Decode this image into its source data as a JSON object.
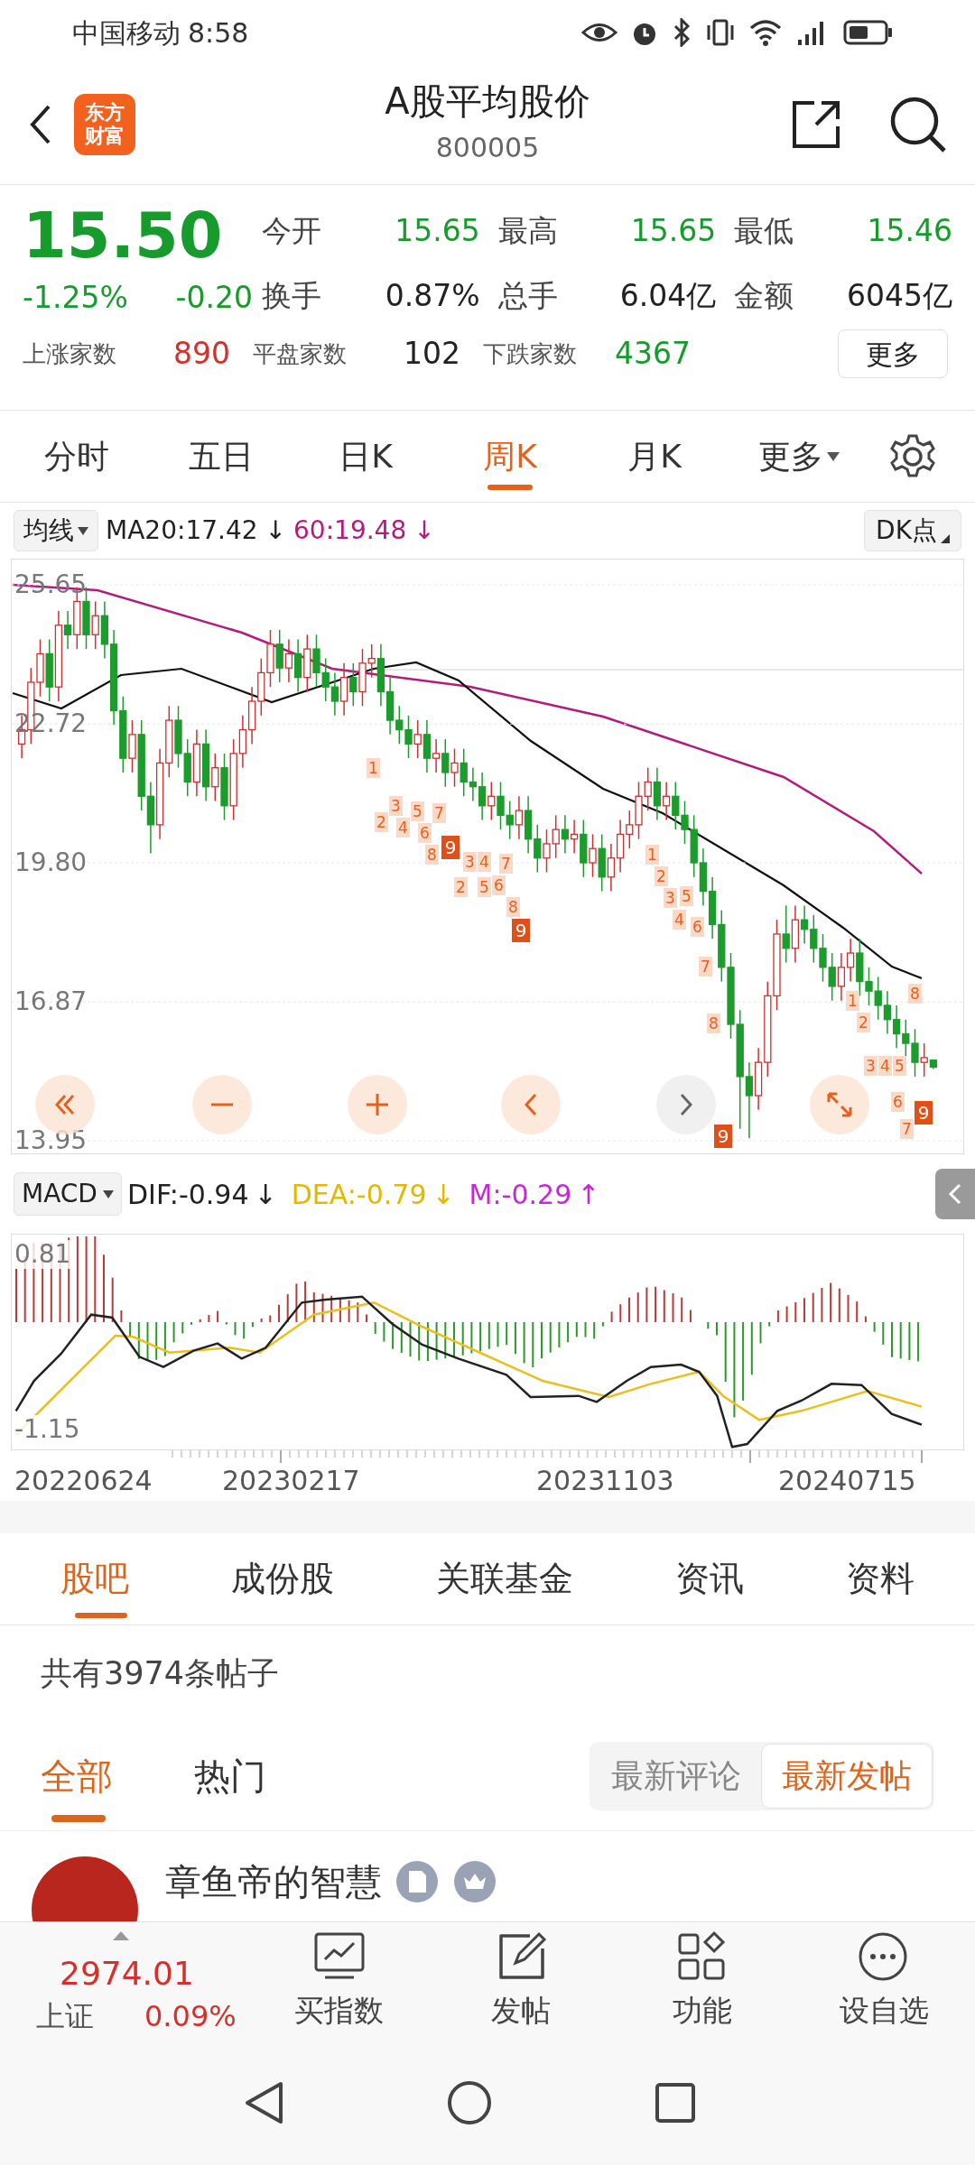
{
  "status_bar": {
    "carrier": "中国移动",
    "time": "8:58"
  },
  "header": {
    "logo_text": [
      "东方",
      "财富"
    ],
    "title": "A股平均股价",
    "code": "800005"
  },
  "quote": {
    "price": "15.50",
    "change_pct": "-1.25%",
    "change": "-0.20",
    "color": "#179b2c",
    "stats": [
      {
        "label": "今开",
        "value": "15.65",
        "color": "#179b2c"
      },
      {
        "label": "最高",
        "value": "15.65",
        "color": "#179b2c"
      },
      {
        "label": "最低",
        "value": "15.46",
        "color": "#179b2c"
      },
      {
        "label": "换手",
        "value": "0.87%",
        "color": "#222222"
      },
      {
        "label": "总手",
        "value": "6.04亿",
        "color": "#222222"
      },
      {
        "label": "金额",
        "value": "6045亿",
        "color": "#222222"
      }
    ],
    "breadth": [
      {
        "label": "上涨家数",
        "value": "890",
        "color": "#d6302a"
      },
      {
        "label": "平盘家数",
        "value": "102",
        "color": "#222222"
      },
      {
        "label": "下跌家数",
        "value": "4367",
        "color": "#179b2c"
      }
    ],
    "more_button": "更多"
  },
  "period_tabs": [
    {
      "label": "分时",
      "selected": false,
      "dropdown": false
    },
    {
      "label": "五日",
      "selected": false,
      "dropdown": false
    },
    {
      "label": "日K",
      "selected": false,
      "dropdown": false
    },
    {
      "label": "周K",
      "selected": true,
      "dropdown": false
    },
    {
      "label": "月K",
      "selected": false,
      "dropdown": false
    },
    {
      "label": "更多",
      "selected": false,
      "dropdown": true
    }
  ],
  "ma_bar": {
    "selector": "均线",
    "ma20": "MA20:17.42",
    "ma20_arrow": "↓",
    "ma60": "60:19.48",
    "ma60_arrow": "↓",
    "signal_button": "DK点"
  },
  "kline": {
    "chart_data": {
      "type": "candlestick",
      "ylim": [
        13.95,
        25.65
      ],
      "grid": true,
      "yticks": [
        {
          "value": 25.65,
          "label": "25.65"
        },
        {
          "value": 22.72,
          "label": "22.72"
        },
        {
          "value": 19.8,
          "label": "19.80"
        },
        {
          "value": 16.87,
          "label": "16.87"
        },
        {
          "value": 13.95,
          "label": "13.95"
        }
      ],
      "ohlc": [
        [
          22.3,
          22.9,
          22.0,
          22.6
        ],
        [
          22.6,
          23.9,
          22.3,
          23.6
        ],
        [
          23.6,
          24.5,
          23.3,
          24.2
        ],
        [
          24.2,
          24.5,
          23.2,
          23.5
        ],
        [
          23.5,
          25.1,
          23.2,
          24.8
        ],
        [
          24.8,
          25.1,
          24.3,
          24.6
        ],
        [
          24.6,
          25.6,
          24.3,
          25.3
        ],
        [
          25.3,
          25.6,
          24.3,
          24.6
        ],
        [
          24.6,
          25.3,
          24.3,
          25.0
        ],
        [
          25.0,
          25.3,
          24.1,
          24.4
        ],
        [
          24.4,
          24.7,
          22.7,
          23.0
        ],
        [
          23.0,
          23.3,
          21.7,
          22.0
        ],
        [
          22.0,
          22.8,
          21.7,
          22.5
        ],
        [
          22.5,
          22.8,
          20.9,
          21.2
        ],
        [
          21.2,
          21.5,
          20.0,
          20.6
        ],
        [
          20.6,
          22.2,
          20.3,
          21.9
        ],
        [
          21.9,
          23.1,
          21.6,
          22.8
        ],
        [
          22.8,
          23.1,
          21.8,
          22.1
        ],
        [
          22.1,
          22.4,
          21.2,
          21.5
        ],
        [
          21.5,
          22.6,
          21.2,
          22.3
        ],
        [
          22.3,
          22.6,
          21.1,
          21.4
        ],
        [
          21.4,
          22.1,
          21.1,
          21.8
        ],
        [
          21.8,
          22.1,
          20.7,
          21.0
        ],
        [
          21.0,
          22.4,
          20.7,
          22.1
        ],
        [
          22.1,
          22.9,
          21.8,
          22.6
        ],
        [
          22.6,
          23.5,
          22.3,
          23.2
        ],
        [
          23.2,
          24.1,
          22.9,
          23.8
        ],
        [
          23.8,
          24.7,
          23.5,
          24.4
        ],
        [
          24.4,
          24.7,
          23.6,
          23.9
        ],
        [
          23.9,
          24.5,
          23.6,
          24.2
        ],
        [
          24.2,
          24.5,
          23.4,
          23.7
        ],
        [
          23.7,
          24.6,
          23.4,
          24.3
        ],
        [
          24.3,
          24.6,
          23.5,
          23.8
        ],
        [
          23.8,
          24.1,
          23.2,
          23.5
        ],
        [
          23.5,
          23.8,
          22.9,
          23.2
        ],
        [
          23.2,
          24.0,
          22.9,
          23.7
        ],
        [
          23.7,
          24.0,
          23.1,
          23.4
        ],
        [
          23.4,
          24.3,
          23.1,
          24.0
        ],
        [
          24.0,
          24.4,
          23.7,
          24.1
        ],
        [
          24.1,
          24.4,
          23.1,
          23.4
        ],
        [
          23.4,
          23.7,
          22.5,
          22.8
        ],
        [
          22.8,
          23.1,
          22.3,
          22.6
        ],
        [
          22.6,
          22.9,
          22.0,
          22.3
        ],
        [
          22.3,
          22.8,
          22.0,
          22.5
        ],
        [
          22.5,
          22.8,
          21.7,
          22.0
        ],
        [
          22.0,
          22.4,
          21.7,
          22.1
        ],
        [
          22.1,
          22.4,
          21.4,
          21.7
        ],
        [
          21.7,
          22.2,
          21.4,
          21.9
        ],
        [
          21.9,
          22.2,
          21.2,
          21.5
        ],
        [
          21.5,
          21.8,
          21.1,
          21.4
        ],
        [
          21.4,
          21.7,
          20.7,
          21.0
        ],
        [
          21.0,
          21.5,
          20.7,
          21.2
        ],
        [
          21.2,
          21.5,
          20.5,
          20.8
        ],
        [
          20.8,
          21.1,
          20.3,
          20.6
        ],
        [
          20.6,
          21.2,
          20.3,
          20.9
        ],
        [
          20.9,
          21.2,
          20.0,
          20.3
        ],
        [
          20.3,
          20.6,
          19.6,
          19.9
        ],
        [
          19.9,
          20.5,
          19.6,
          20.2
        ],
        [
          20.2,
          20.8,
          19.9,
          20.5
        ],
        [
          20.5,
          20.8,
          20.0,
          20.3
        ],
        [
          20.3,
          20.7,
          20.0,
          20.4
        ],
        [
          20.4,
          20.7,
          19.5,
          19.8
        ],
        [
          19.8,
          20.4,
          19.5,
          20.1
        ],
        [
          20.1,
          20.4,
          19.2,
          19.5
        ],
        [
          19.5,
          20.2,
          19.2,
          19.9
        ],
        [
          19.9,
          20.7,
          19.6,
          20.4
        ],
        [
          20.4,
          20.9,
          20.1,
          20.6
        ],
        [
          20.6,
          21.5,
          20.3,
          21.2
        ],
        [
          21.2,
          21.8,
          20.9,
          21.5
        ],
        [
          21.5,
          21.8,
          20.7,
          21.0
        ],
        [
          21.0,
          21.5,
          20.7,
          21.2
        ],
        [
          21.2,
          21.5,
          20.5,
          20.8
        ],
        [
          20.8,
          21.1,
          20.2,
          20.5
        ],
        [
          20.5,
          20.8,
          19.5,
          19.8
        ],
        [
          19.8,
          20.1,
          18.9,
          19.2
        ],
        [
          19.2,
          19.5,
          18.2,
          18.5
        ],
        [
          18.5,
          18.8,
          17.3,
          17.6
        ],
        [
          17.6,
          17.9,
          16.1,
          16.4
        ],
        [
          16.4,
          16.7,
          14.2,
          15.3
        ],
        [
          15.3,
          15.6,
          14.0,
          14.9
        ],
        [
          14.9,
          15.9,
          14.6,
          15.6
        ],
        [
          15.6,
          17.3,
          15.3,
          17.0
        ],
        [
          17.0,
          18.6,
          16.7,
          18.3
        ],
        [
          18.3,
          18.9,
          17.7,
          18.0
        ],
        [
          18.0,
          18.9,
          17.7,
          18.6
        ],
        [
          18.6,
          18.9,
          18.1,
          18.4
        ],
        [
          18.4,
          18.7,
          17.7,
          18.0
        ],
        [
          18.0,
          18.3,
          17.3,
          17.6
        ],
        [
          17.6,
          17.9,
          16.9,
          17.2
        ],
        [
          17.2,
          17.9,
          16.9,
          17.6
        ],
        [
          17.6,
          18.2,
          17.3,
          17.9
        ],
        [
          17.9,
          18.2,
          17.0,
          17.3
        ],
        [
          17.3,
          17.6,
          16.8,
          17.1
        ],
        [
          17.1,
          17.4,
          16.5,
          16.8
        ],
        [
          16.8,
          17.1,
          16.2,
          16.5
        ],
        [
          16.5,
          16.8,
          15.9,
          16.2
        ],
        [
          16.2,
          16.5,
          15.7,
          16.0
        ],
        [
          16.0,
          16.3,
          15.3,
          15.6
        ],
        [
          15.6,
          16.0,
          15.3,
          15.7
        ],
        [
          15.65,
          15.65,
          15.46,
          15.5
        ]
      ]
    },
    "td_marks": [
      {
        "text": "1",
        "kind": "count"
      },
      {
        "text": "2",
        "kind": "count"
      },
      {
        "text": "3",
        "kind": "count"
      },
      {
        "text": "4",
        "kind": "count"
      },
      {
        "text": "5",
        "kind": "count"
      },
      {
        "text": "6",
        "kind": "count"
      },
      {
        "text": "7",
        "kind": "count"
      },
      {
        "text": "8",
        "kind": "count"
      },
      {
        "text": "9",
        "kind": "final"
      },
      {
        "text": "2",
        "kind": "count"
      },
      {
        "text": "3",
        "kind": "count"
      },
      {
        "text": "4",
        "kind": "count"
      },
      {
        "text": "5",
        "kind": "count"
      },
      {
        "text": "6",
        "kind": "count"
      },
      {
        "text": "7",
        "kind": "count"
      },
      {
        "text": "8",
        "kind": "count"
      },
      {
        "text": "9",
        "kind": "final"
      },
      {
        "text": "1",
        "kind": "count"
      },
      {
        "text": "2",
        "kind": "count"
      },
      {
        "text": "3",
        "kind": "count"
      },
      {
        "text": "4",
        "kind": "count"
      },
      {
        "text": "5",
        "kind": "count"
      },
      {
        "text": "6",
        "kind": "count"
      },
      {
        "text": "7",
        "kind": "count"
      },
      {
        "text": "8",
        "kind": "count"
      },
      {
        "text": "9",
        "kind": "final"
      },
      {
        "text": "1",
        "kind": "count"
      },
      {
        "text": "2",
        "kind": "count"
      },
      {
        "text": "3",
        "kind": "count"
      },
      {
        "text": "4",
        "kind": "count"
      },
      {
        "text": "5",
        "kind": "count"
      },
      {
        "text": "6",
        "kind": "count"
      },
      {
        "text": "7",
        "kind": "count"
      },
      {
        "text": "8",
        "kind": "count"
      },
      {
        "text": "9",
        "kind": "final"
      }
    ]
  },
  "macd": {
    "selector": "MACD",
    "dif": "DIF:-0.94",
    "dif_arrow": "↓",
    "dea": "DEA:-0.79",
    "dea_arrow": "↓",
    "m": "M:-0.29",
    "m_arrow": "↑",
    "y_labels": [
      "0.81",
      "-1.15"
    ],
    "dates": [
      "20220624",
      "20230217",
      "20231103",
      "20240715"
    ]
  },
  "content_tabs": [
    {
      "label": "股吧",
      "selected": true
    },
    {
      "label": "成份股",
      "selected": false
    },
    {
      "label": "关联基金",
      "selected": false
    },
    {
      "label": "资讯",
      "selected": false
    },
    {
      "label": "资料",
      "selected": false
    }
  ],
  "post_count": "共有3974条帖子",
  "feed_tabs": [
    {
      "label": "全部",
      "selected": true
    },
    {
      "label": "热门",
      "selected": false
    }
  ],
  "sort_options": [
    {
      "label": "最新评论",
      "selected": false
    },
    {
      "label": "最新发帖",
      "selected": true
    }
  ],
  "posts": [
    {
      "author": "章鱼帝的智慧"
    }
  ],
  "bottom_bar": {
    "index_value": "2974.01",
    "index_name": "上证",
    "index_change": "0.09%",
    "color": "#d6302a",
    "actions": [
      {
        "label": "买指数",
        "kind": "buy"
      },
      {
        "label": "发帖",
        "kind": "post"
      },
      {
        "label": "功能",
        "kind": "apps"
      },
      {
        "label": "设自选",
        "kind": "watch"
      }
    ]
  }
}
